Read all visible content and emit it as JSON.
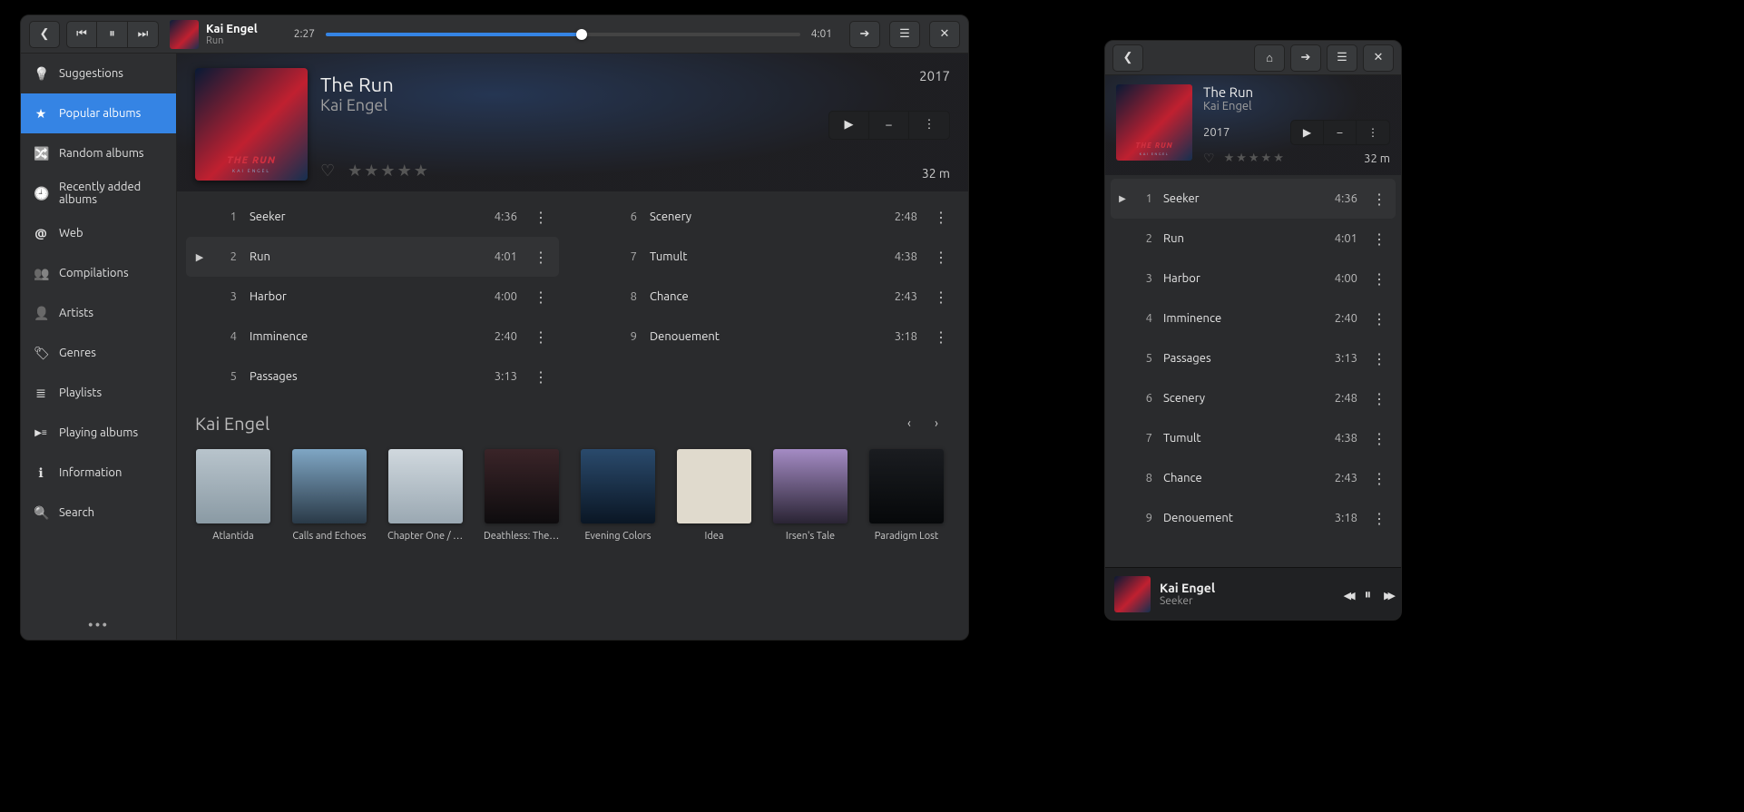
{
  "player": {
    "artist": "Kai Engel",
    "track": "Run",
    "elapsed": "2:27",
    "total": "4:01",
    "progress_pct": 54
  },
  "sidebar": {
    "items": [
      {
        "icon": "bulb",
        "label": "Suggestions"
      },
      {
        "icon": "star",
        "label": "Popular albums",
        "active": true
      },
      {
        "icon": "shuffle",
        "label": "Random albums"
      },
      {
        "icon": "clock",
        "label": "Recently added albums"
      },
      {
        "icon": "web",
        "label": "Web"
      },
      {
        "icon": "people",
        "label": "Compilations"
      },
      {
        "icon": "person",
        "label": "Artists"
      },
      {
        "icon": "tag",
        "label": "Genres"
      },
      {
        "icon": "list",
        "label": "Playlists"
      },
      {
        "icon": "playing",
        "label": "Playing albums"
      },
      {
        "icon": "info",
        "label": "Information"
      },
      {
        "icon": "search",
        "label": "Search"
      }
    ]
  },
  "album": {
    "title": "The Run",
    "artist": "Kai Engel",
    "year": "2017",
    "duration": "32 m",
    "cover_text": "THE RUN",
    "cover_sub": "KAI ENGEL",
    "tracks": [
      {
        "n": "1",
        "title": "Seeker",
        "dur": "4:36"
      },
      {
        "n": "2",
        "title": "Run",
        "dur": "4:01",
        "playing": true
      },
      {
        "n": "3",
        "title": "Harbor",
        "dur": "4:00"
      },
      {
        "n": "4",
        "title": "Imminence",
        "dur": "2:40"
      },
      {
        "n": "5",
        "title": "Passages",
        "dur": "3:13"
      },
      {
        "n": "6",
        "title": "Scenery",
        "dur": "2:48"
      },
      {
        "n": "7",
        "title": "Tumult",
        "dur": "4:38"
      },
      {
        "n": "8",
        "title": "Chance",
        "dur": "2:43"
      },
      {
        "n": "9",
        "title": "Denouement",
        "dur": "3:18"
      }
    ]
  },
  "more_by": {
    "heading": "Kai Engel",
    "albums": [
      {
        "title": "Atlantida",
        "cover": "linear-gradient(#b8c4cc,#8a9aa4)"
      },
      {
        "title": "Calls and Echoes",
        "cover": "linear-gradient(#7fa6c4,#2a3a48)"
      },
      {
        "title": "Chapter One / C…",
        "cover": "linear-gradient(#d0d8de,#9aa8b2)"
      },
      {
        "title": "Deathless: The R…",
        "cover": "linear-gradient(#3a2428,#0e0c0e)"
      },
      {
        "title": "Evening Colors",
        "cover": "linear-gradient(#2a4a6c,#0a1624)"
      },
      {
        "title": "Idea",
        "cover": "#e0dacd"
      },
      {
        "title": "Irsen's Tale",
        "cover": "linear-gradient(#a48bc4,#2a2434)"
      },
      {
        "title": "Paradigm Lost",
        "cover": "linear-gradient(#1a1c20,#06080a)"
      }
    ]
  },
  "compact": {
    "title": "The Run",
    "artist": "Kai Engel",
    "year": "2017",
    "duration": "32 m",
    "selected_index": 0,
    "tracks": [
      {
        "n": "1",
        "title": "Seeker",
        "dur": "4:36"
      },
      {
        "n": "2",
        "title": "Run",
        "dur": "4:01"
      },
      {
        "n": "3",
        "title": "Harbor",
        "dur": "4:00"
      },
      {
        "n": "4",
        "title": "Imminence",
        "dur": "2:40"
      },
      {
        "n": "5",
        "title": "Passages",
        "dur": "3:13"
      },
      {
        "n": "6",
        "title": "Scenery",
        "dur": "2:48"
      },
      {
        "n": "7",
        "title": "Tumult",
        "dur": "4:38"
      },
      {
        "n": "8",
        "title": "Chance",
        "dur": "2:43"
      },
      {
        "n": "9",
        "title": "Denouement",
        "dur": "3:18"
      }
    ],
    "footer_artist": "Kai Engel",
    "footer_track": "Seeker"
  }
}
